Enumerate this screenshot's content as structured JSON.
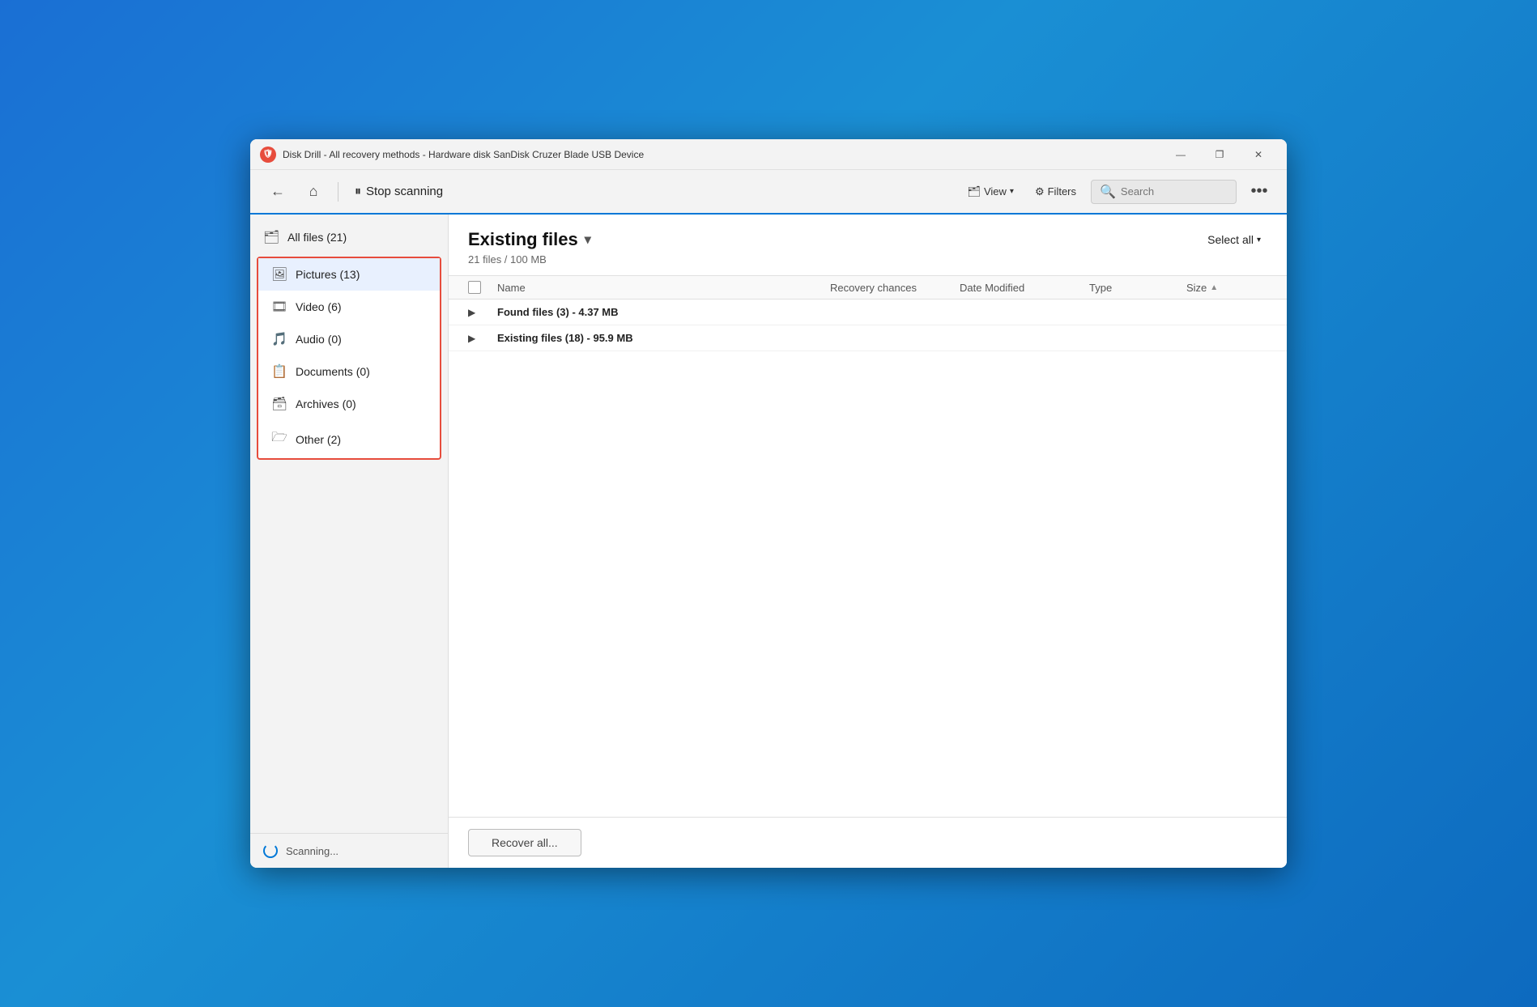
{
  "window": {
    "title": "Disk Drill - All recovery methods - Hardware disk SanDisk Cruzer Blade USB Device",
    "icon": "🛡"
  },
  "titlebar_controls": {
    "minimize": "—",
    "maximize": "❐",
    "close": "✕"
  },
  "toolbar": {
    "back_label": "←",
    "home_label": "⌂",
    "pause_label": "⏸",
    "stop_scanning_label": "Stop scanning",
    "view_label": "View",
    "filters_label": "Filters",
    "search_placeholder": "Search",
    "more_label": "•••"
  },
  "sidebar": {
    "items": [
      {
        "id": "all-files",
        "icon": "🗂",
        "label": "All files (21)",
        "active": false,
        "in_group": false
      },
      {
        "id": "pictures",
        "icon": "🖼",
        "label": "Pictures (13)",
        "active": true,
        "in_group": true
      },
      {
        "id": "video",
        "icon": "🎞",
        "label": "Video (6)",
        "active": false,
        "in_group": true
      },
      {
        "id": "audio",
        "icon": "🎵",
        "label": "Audio (0)",
        "active": false,
        "in_group": true
      },
      {
        "id": "documents",
        "icon": "📋",
        "label": "Documents (0)",
        "active": false,
        "in_group": true
      },
      {
        "id": "archives",
        "icon": "🗃",
        "label": "Archives (0)",
        "active": false,
        "in_group": true
      },
      {
        "id": "other",
        "icon": "🗁",
        "label": "Other (2)",
        "active": false,
        "in_group": true
      }
    ],
    "scanning_text": "Scanning..."
  },
  "content": {
    "title": "Existing files",
    "subtitle": "21 files / 100 MB",
    "select_all_label": "Select all",
    "columns": {
      "name": "Name",
      "recovery_chances": "Recovery chances",
      "date_modified": "Date Modified",
      "type": "Type",
      "size": "Size"
    },
    "rows": [
      {
        "id": "found-files",
        "name": "Found files (3) - 4.37 MB",
        "recovery_chances": "",
        "date_modified": "",
        "type": "",
        "size": ""
      },
      {
        "id": "existing-files",
        "name": "Existing files (18) - 95.9 MB",
        "recovery_chances": "",
        "date_modified": "",
        "type": "",
        "size": ""
      }
    ],
    "recover_all_label": "Recover all..."
  }
}
